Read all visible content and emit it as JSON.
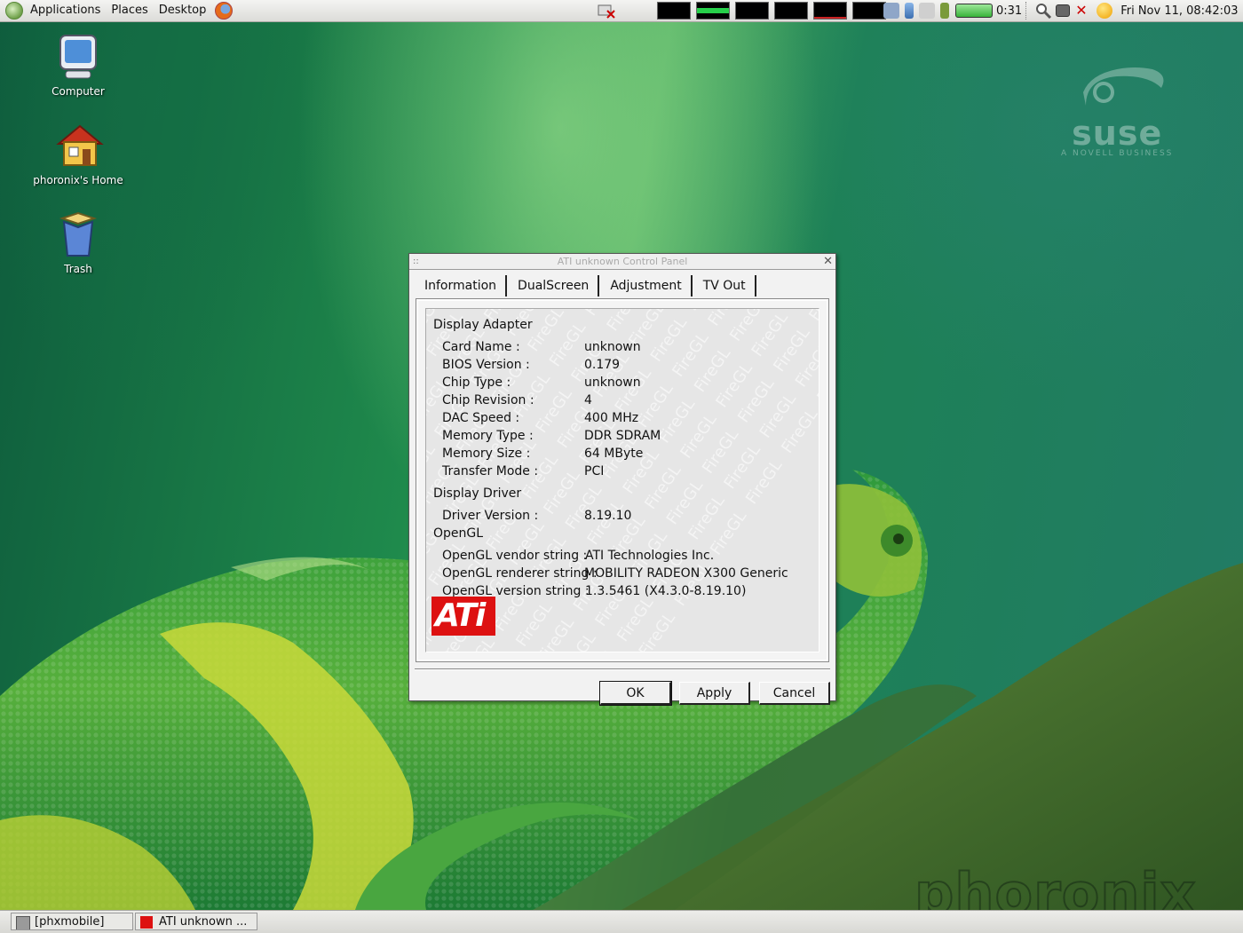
{
  "top_panel": {
    "menus": [
      "Applications",
      "Places",
      "Desktop"
    ],
    "battery_time": "0:31",
    "clock": "Fri Nov 11, 08:42:03"
  },
  "desktop": {
    "icons": [
      {
        "label": "Computer",
        "icon": "computer-icon"
      },
      {
        "label": "phoronix's Home",
        "icon": "home-folder-icon"
      },
      {
        "label": "Trash",
        "icon": "trash-icon"
      }
    ],
    "watermarks": {
      "suse_word": "suse",
      "suse_sub": "A NOVELL BUSINESS",
      "phoronix": "phoronix"
    }
  },
  "dialog": {
    "title": "ATI unknown Control Panel",
    "tabs": [
      "Information",
      "DualScreen",
      "Adjustment",
      "TV Out"
    ],
    "active_tab": "Information",
    "background_watermark": "FireGL",
    "sections": {
      "display_adapter": {
        "heading": "Display Adapter",
        "rows": [
          {
            "label": "Card Name :",
            "value": "unknown"
          },
          {
            "label": "BIOS Version :",
            "value": "0.179"
          },
          {
            "label": "Chip Type :",
            "value": "unknown"
          },
          {
            "label": "Chip Revision :",
            "value": "4"
          },
          {
            "label": "DAC Speed :",
            "value": "400 MHz"
          },
          {
            "label": "Memory Type :",
            "value": "DDR SDRAM"
          },
          {
            "label": "Memory Size :",
            "value": "64 MByte"
          },
          {
            "label": "Transfer Mode :",
            "value": "PCI"
          }
        ]
      },
      "display_driver": {
        "heading": "Display Driver",
        "rows": [
          {
            "label": "Driver Version :",
            "value": "8.19.10"
          }
        ]
      },
      "opengl": {
        "heading": "OpenGL",
        "rows": [
          {
            "label": "OpenGL vendor string :",
            "value": "ATI Technologies Inc."
          },
          {
            "label": "OpenGL renderer string :",
            "value": "MOBILITY RADEON X300 Generic"
          },
          {
            "label": "OpenGL version string :",
            "value": "1.3.5461 (X4.3.0-8.19.10)"
          }
        ]
      }
    },
    "logo_text": "ATi",
    "buttons": {
      "ok": "OK",
      "apply": "Apply",
      "cancel": "Cancel"
    }
  },
  "taskbar": {
    "tasks": [
      {
        "label": "[phxmobile]",
        "icon": "terminal-icon"
      },
      {
        "label": "ATI unknown ...",
        "icon": "ati-icon"
      }
    ]
  },
  "colors": {
    "ati_red": "#dd1111",
    "wallpaper_green": "#1f8a4c"
  }
}
